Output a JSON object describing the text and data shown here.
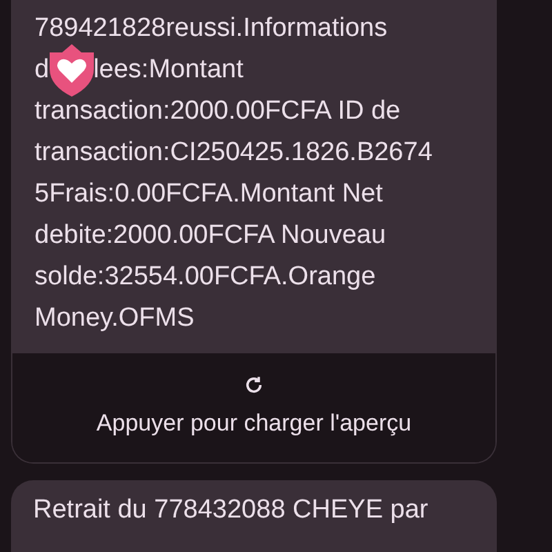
{
  "message": {
    "lines": [
      {
        "parts": [
          "789421828reussi.Informations"
        ]
      },
      {
        "parts": [
          "d",
          {
            "kind": "reaction"
          },
          "lees:Montant"
        ]
      },
      {
        "parts": [
          "transaction:2000.00FCFA ID de"
        ]
      },
      {
        "parts": [
          "transaction:CI250425.1826.B2674"
        ]
      },
      {
        "parts": [
          "5Frais:0.00FCFA.Montant Net"
        ]
      },
      {
        "parts": [
          "debite:2000.00FCFA Nouveau"
        ]
      },
      {
        "parts": [
          "solde:32554.00FCFA.Orange"
        ]
      },
      {
        "parts": [
          "Money.OFMS"
        ]
      }
    ],
    "preview": {
      "label": "Appuyer pour charger l'aperçu"
    }
  },
  "next_message": {
    "text": "Retrait du 778432088 CHEYE par"
  }
}
